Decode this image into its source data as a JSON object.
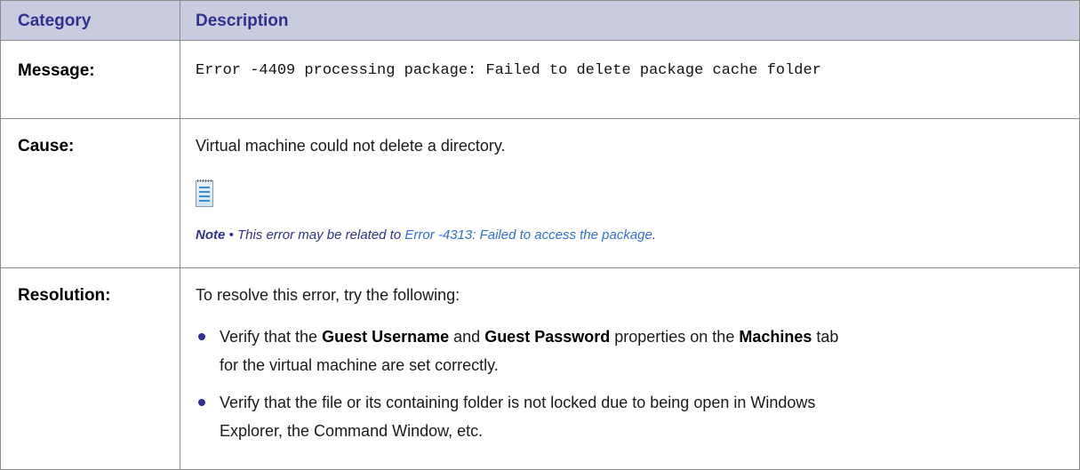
{
  "header": {
    "category": "Category",
    "description": "Description"
  },
  "message": {
    "label": "Message:",
    "text": "Error -4409 processing package: Failed to delete package cache folder"
  },
  "cause": {
    "label": "Cause:",
    "text": "Virtual machine could not delete a directory.",
    "note_icon": "notepad-icon",
    "note": {
      "prefix": "Note",
      "separator": "•",
      "text": "This error may be related to",
      "link_text": "Error -4313: Failed to access the package",
      "suffix": "."
    }
  },
  "resolution": {
    "label": "Resolution:",
    "intro": "To resolve this error, try the following:",
    "bullets": [
      {
        "parts": [
          "Verify that the ",
          "Guest Username",
          " and ",
          "Guest Password",
          " properties on the ",
          "Machines",
          " tab"
        ],
        "line2": "for the virtual machine are set correctly."
      },
      {
        "line1": "Verify that the file or its containing folder is not locked due to being open in Windows",
        "line2": "Explorer, the Command Window, etc."
      }
    ]
  },
  "colors": {
    "header_bg": "#c9cbde",
    "header_text": "#2e3192",
    "link": "#2f6fd6",
    "border": "#8c8c8c"
  }
}
